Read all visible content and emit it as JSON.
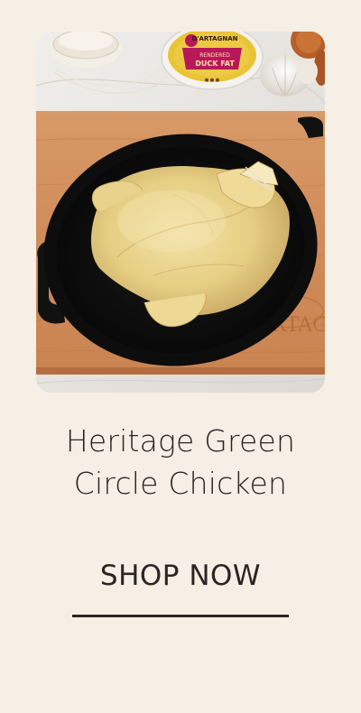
{
  "product": {
    "image_alt": "Heritage Green Circle Chicken in a black oval roasting pan",
    "title_line1": "Heritage Green",
    "title_line2": "Circle Chicken"
  },
  "cta": {
    "label": "SHOP NOW"
  },
  "photo_text": {
    "tub_brand": "D'ARTAGNAN",
    "tub_product": "RENDERED",
    "tub_product2": "DUCK FAT",
    "board_brand": "D'ARTAGN"
  },
  "colors": {
    "background": "#f6efe5",
    "text": "#2b2523"
  }
}
